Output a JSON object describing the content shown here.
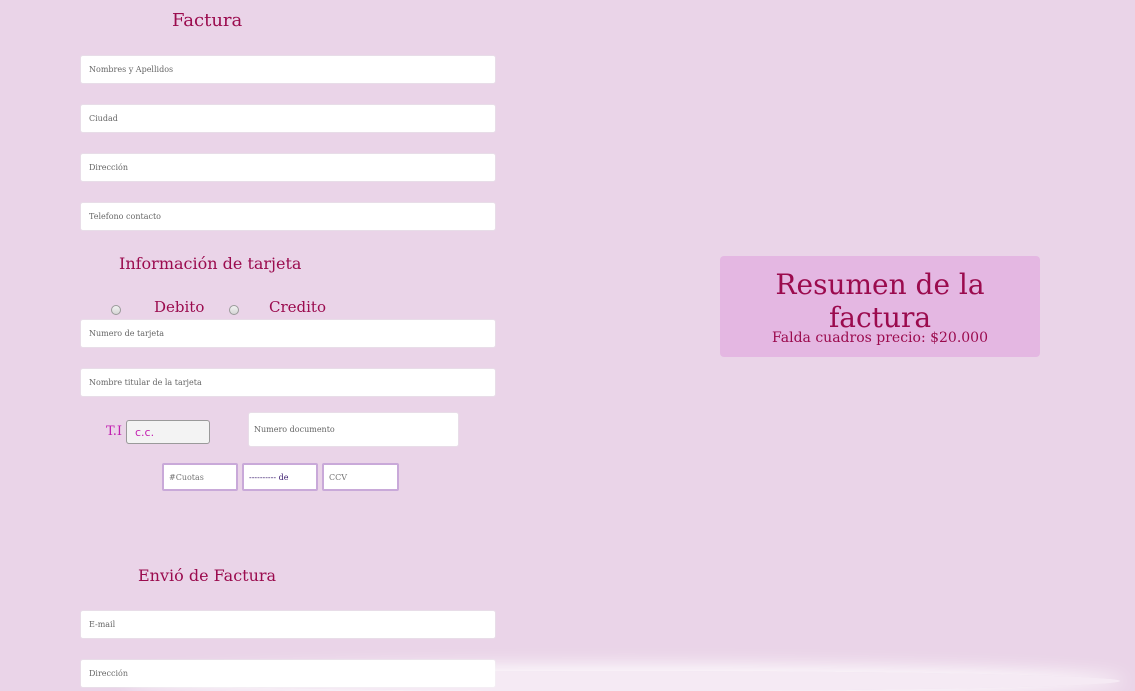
{
  "factura": {
    "title": "Factura",
    "fields": [
      {
        "placeholder": "Nombres y Apellidos"
      },
      {
        "placeholder": "Ciudad"
      },
      {
        "placeholder": "Dirección"
      },
      {
        "placeholder": "Telefono contacto"
      }
    ]
  },
  "tarjeta": {
    "title": "Información de tarjeta",
    "radio_debito": "Debito",
    "radio_credito": "Credito",
    "numero_placeholder": "Numero de tarjeta",
    "titular_placeholder": "Nombre titular de la tarjeta",
    "ti_label": "T.I",
    "doc_type_value": "c.c.",
    "numero_documento_placeholder": "Numero documento",
    "cuotas_placeholder": "#Cuotas",
    "fecha_value": "---------- de",
    "ccv_placeholder": "CCV"
  },
  "envio": {
    "title": "Envió de Factura",
    "email_placeholder": "E-mail",
    "direccion_placeholder": "Dirección"
  },
  "resumen": {
    "title": "Resumen de la factura",
    "line": "Falda cuadros precio: $20.000"
  },
  "colors": {
    "background": "#ead4e8",
    "heading": "#9b0b4e",
    "summary_bg": "#e4b7e2",
    "ti_label": "#c21fb0"
  }
}
